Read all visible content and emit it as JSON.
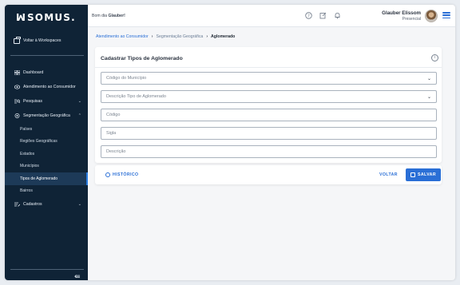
{
  "app": {
    "logo_mark": "ꟽ",
    "logo_text": "somus."
  },
  "sidebar": {
    "workspace_label": "Voltar à Workspaces",
    "items": [
      {
        "label": "Dashboard"
      },
      {
        "label": "Atendimento ao Consumidor"
      },
      {
        "label": "Pesquisas"
      },
      {
        "label": "Segmentação Geográfica"
      }
    ],
    "sub_items": [
      {
        "label": "Países"
      },
      {
        "label": "Regiões Geográficas"
      },
      {
        "label": "Estados"
      },
      {
        "label": "Municípios"
      },
      {
        "label": "Tipos de Aglomerado",
        "active": true
      },
      {
        "label": "Bairros"
      }
    ],
    "cadastros_label": "Cadastros",
    "collapse_icon": "collapse-sidebar-icon"
  },
  "topbar": {
    "greeting_prefix": "Bom dia",
    "greeting_name": "Glauber!",
    "user_name": "Glauber Elissom",
    "user_status": "Presencial"
  },
  "breadcrumb": {
    "items": [
      "Atendimento ao Consumidor",
      "Segmentação Geográfica",
      "Aglomerado"
    ]
  },
  "form": {
    "title": "Cadastrar Tipos de Aglomerado",
    "fields": [
      {
        "placeholder": "Código do Município",
        "type": "select"
      },
      {
        "placeholder": "Descrição Tipo de Aglomerado",
        "type": "select"
      },
      {
        "placeholder": "Código",
        "type": "text"
      },
      {
        "placeholder": "Sigla",
        "type": "text"
      },
      {
        "placeholder": "Descrição",
        "type": "text"
      }
    ]
  },
  "actions": {
    "history_label": "HISTÓRICO",
    "back_label": "VOLTAR",
    "save_label": "SALVAR"
  },
  "colors": {
    "sidebar_bg": "#0f2336",
    "accent": "#2a6fd6"
  }
}
